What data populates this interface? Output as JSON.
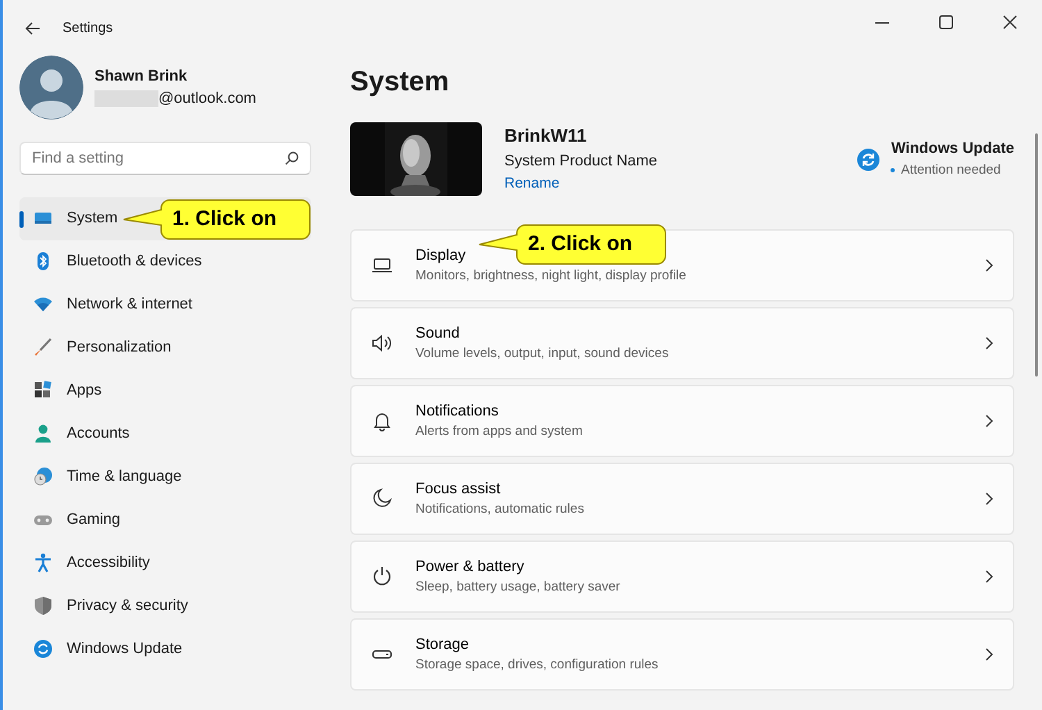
{
  "window": {
    "title": "Settings"
  },
  "account": {
    "name": "Shawn Brink",
    "email": "@outlook.com"
  },
  "search": {
    "placeholder": "Find a setting"
  },
  "nav": [
    {
      "label": "System",
      "selected": true
    },
    {
      "label": "Bluetooth & devices",
      "selected": false
    },
    {
      "label": "Network & internet",
      "selected": false
    },
    {
      "label": "Personalization",
      "selected": false
    },
    {
      "label": "Apps",
      "selected": false
    },
    {
      "label": "Accounts",
      "selected": false
    },
    {
      "label": "Time & language",
      "selected": false
    },
    {
      "label": "Gaming",
      "selected": false
    },
    {
      "label": "Accessibility",
      "selected": false
    },
    {
      "label": "Privacy & security",
      "selected": false
    },
    {
      "label": "Windows Update",
      "selected": false
    }
  ],
  "page": {
    "title": "System",
    "device": {
      "name": "BrinkW11",
      "model": "System Product Name",
      "rename": "Rename"
    },
    "update": {
      "title": "Windows Update",
      "status": "Attention needed"
    }
  },
  "cards": [
    {
      "title": "Display",
      "subtitle": "Monitors, brightness, night light, display profile"
    },
    {
      "title": "Sound",
      "subtitle": "Volume levels, output, input, sound devices"
    },
    {
      "title": "Notifications",
      "subtitle": "Alerts from apps and system"
    },
    {
      "title": "Focus assist",
      "subtitle": "Notifications, automatic rules"
    },
    {
      "title": "Power & battery",
      "subtitle": "Sleep, battery usage, battery saver"
    },
    {
      "title": "Storage",
      "subtitle": "Storage space, drives, configuration rules"
    }
  ],
  "callouts": [
    {
      "text": "1. Click on"
    },
    {
      "text": "2. Click on"
    }
  ]
}
